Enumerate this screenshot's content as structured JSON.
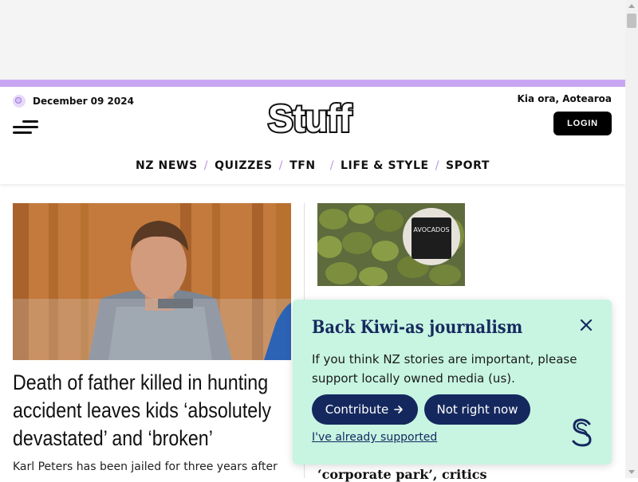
{
  "header": {
    "date": "December 09 2024",
    "greeting": "Kia ora, Aotearoa",
    "logo_text": "Stuff",
    "login_label": "LOGIN"
  },
  "nav": {
    "items": [
      "NZ NEWS",
      "QUIZZES",
      "TFN",
      "LIFE & STYLE",
      "SPORT"
    ]
  },
  "lead_story": {
    "headline_lines": [
      "Death of father killed in hunting",
      "accident leaves kids ‘absolutely",
      "devastated’ and ‘broken’"
    ],
    "summary": "Karl Peters has been jailed for three years after"
  },
  "side_story": {
    "sign_text": "AVOCADOS",
    "headline_partial": "‘corporate park’, critics"
  },
  "popup": {
    "title": "Back Kiwi-as journalism",
    "body": "If you think NZ stories are important, please support locally owned media (us).",
    "contribute_label": "Contribute",
    "not_now_label": "Not right now",
    "already_label": "I've already supported"
  },
  "colors": {
    "accent": "#c9a6f3",
    "popup_bg": "#c7f5e2",
    "popup_navy": "#15285e",
    "black": "#000000"
  },
  "icons": {
    "menu": "hamburger-menu-icon",
    "date": "radio-live-icon",
    "close": "close-icon",
    "arrow": "arrow-right-icon",
    "brand": "stuff-s-icon"
  }
}
